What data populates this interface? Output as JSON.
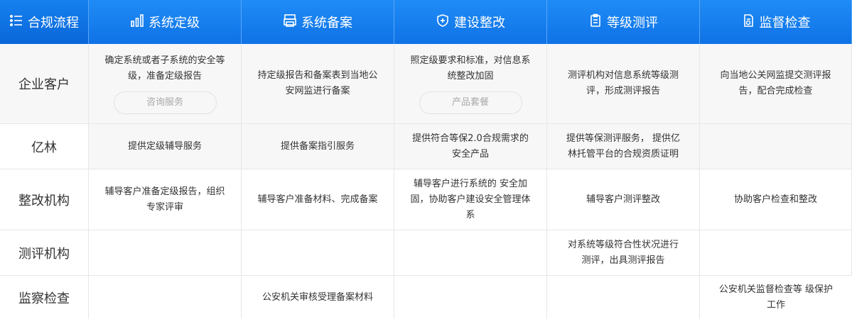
{
  "header": {
    "corner": "合规流程",
    "steps": [
      "系统定级",
      "系统备案",
      "建设整改",
      "等级测评",
      "监督检查"
    ]
  },
  "rows": [
    {
      "label": "企业客户",
      "cells": [
        "确定系统或者子系统的安全等级，准备定级报告",
        "持定级报告和备案表到当地公安网监进行备案",
        "照定级要求和标准，对信息系统整改加固",
        "测评机构对信息系统等级测评，形成测评报告",
        "向当地公关网监提交测评报告，配合完成检查"
      ],
      "buttons": {
        "consult": "咨询服务",
        "product": "产品套餐"
      }
    },
    {
      "label": "亿林",
      "cells": [
        "提供定级辅导服务",
        "提供备案指引服务",
        "提供符合等保2.0合规需求的安全产品",
        "提供等保测评服务， 提供亿林托管平台的合规资质证明",
        ""
      ]
    },
    {
      "label": "整改机构",
      "cells": [
        "辅导客户准备定级报告，组织专家评审",
        "辅导客户准备材料、完成备案",
        "辅导客户进行系统的 安全加固，协助客户建设安全管理体系",
        "辅导客户测评整改",
        "协助客户检查和整改"
      ]
    },
    {
      "label": "测评机构",
      "cells": [
        "",
        "",
        "",
        "对系统等级符合性状况进行 测评，出具测评报告",
        ""
      ]
    },
    {
      "label": "监察检查",
      "cells": [
        "",
        "公安机关审核受理备案材料",
        "",
        "",
        "公安机关监督检查等 级保护工作"
      ]
    }
  ],
  "colors": {
    "header_blue": "#1580ee",
    "row_gray": "#f7f7f7",
    "border": "#e7e7e7"
  }
}
